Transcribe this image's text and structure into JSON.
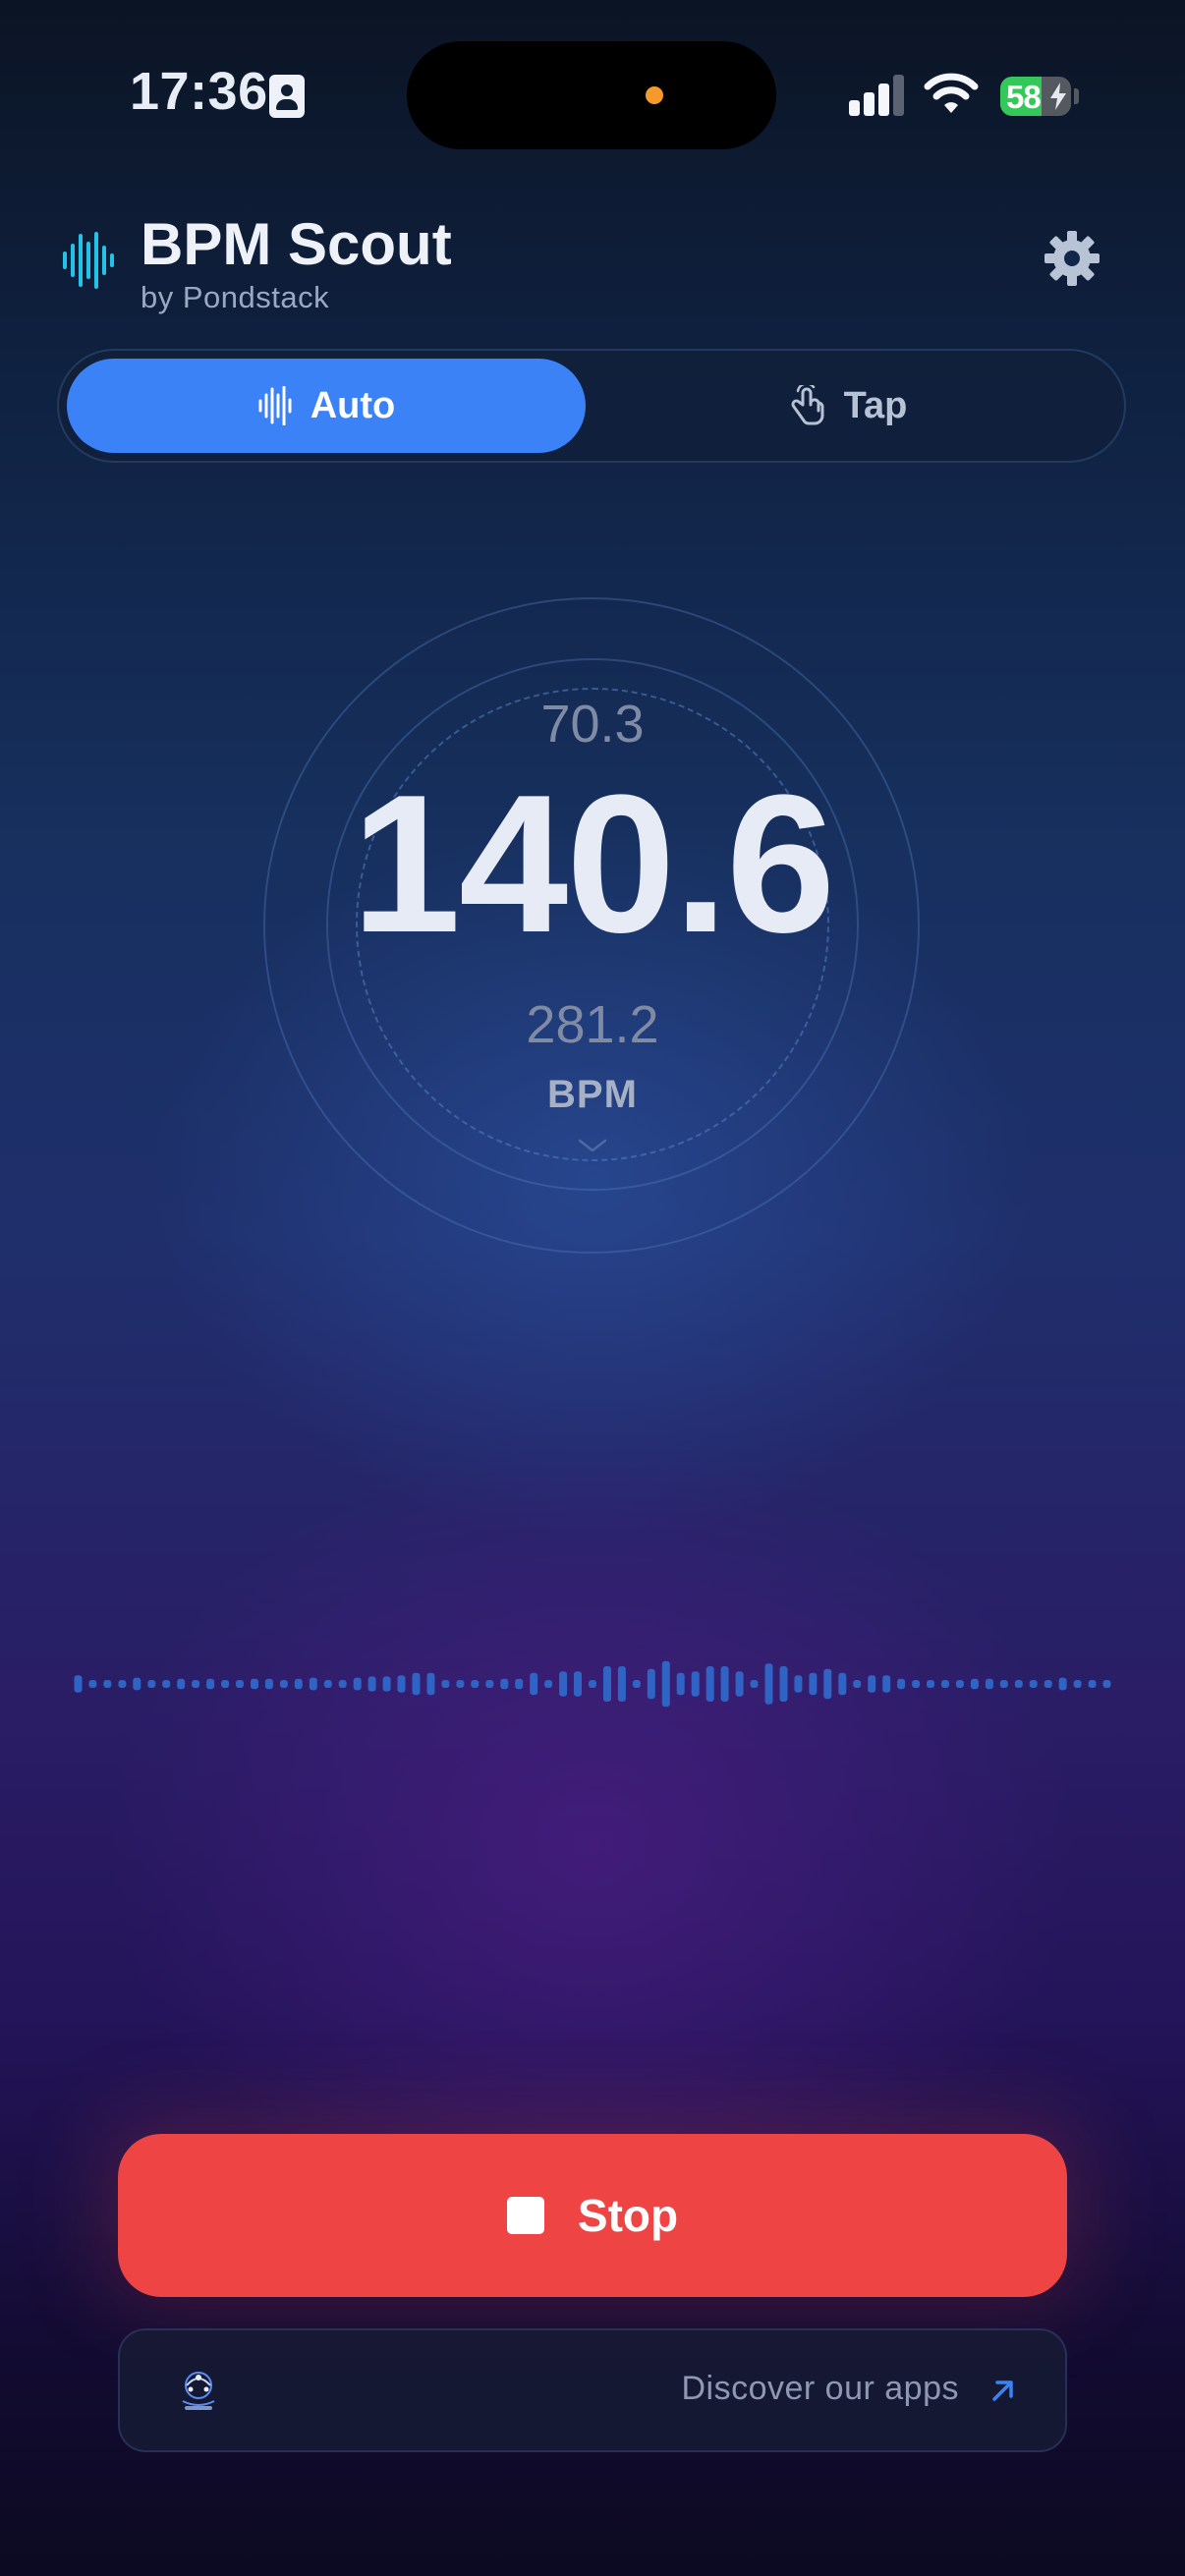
{
  "status_bar": {
    "time": "17:36",
    "battery_level": "58",
    "icons": [
      "id-card-icon",
      "signal-icon",
      "wifi-icon",
      "battery-charging-icon"
    ]
  },
  "header": {
    "title": "BPM Scout",
    "subtitle": "by Pondstack",
    "icons": [
      "waveform-logo-icon",
      "gear-icon"
    ]
  },
  "mode_tabs": [
    {
      "label": "Auto",
      "icon": "waveform-icon",
      "selected": true
    },
    {
      "label": "Tap",
      "icon": "hand-tap-icon",
      "selected": false
    }
  ],
  "readout": {
    "half_tempo": "70.3",
    "tempo": "140.6",
    "double_tempo": "281.2",
    "unit": "BPM"
  },
  "waveform": {
    "levels": [
      0.22,
      0.1,
      0.1,
      0.1,
      0.16,
      0.1,
      0.1,
      0.13,
      0.1,
      0.13,
      0.1,
      0.1,
      0.13,
      0.13,
      0.1,
      0.13,
      0.16,
      0.1,
      0.1,
      0.16,
      0.19,
      0.19,
      0.22,
      0.28,
      0.28,
      0.1,
      0.1,
      0.1,
      0.1,
      0.13,
      0.13,
      0.28,
      0.1,
      0.32,
      0.32,
      0.1,
      0.45,
      0.45,
      0.1,
      0.38,
      0.58,
      0.28,
      0.32,
      0.45,
      0.45,
      0.32,
      0.1,
      0.52,
      0.45,
      0.22,
      0.28,
      0.38,
      0.28,
      0.1,
      0.22,
      0.22,
      0.13,
      0.1,
      0.1,
      0.1,
      0.1,
      0.13,
      0.13,
      0.1,
      0.1,
      0.1,
      0.1,
      0.16,
      0.1,
      0.1,
      0.1
    ]
  },
  "controls": {
    "stop_label": "Stop"
  },
  "footer": {
    "discover_label": "Discover our apps",
    "icons": [
      "pondstack-logo-icon",
      "arrow-up-right-icon"
    ]
  },
  "colors": {
    "accent": "#3b82f6",
    "stop": "#ef4444",
    "waveform": "#2f63c4",
    "logo": "#22c3e6"
  }
}
